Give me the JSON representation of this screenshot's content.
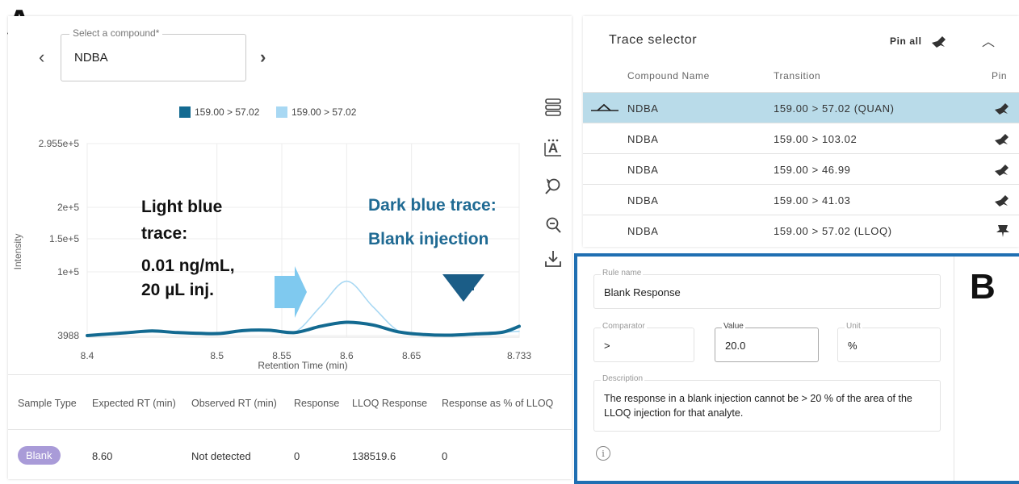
{
  "panel_labels": {
    "a": "A",
    "b": "B"
  },
  "compound_select": {
    "label": "Select a compound*",
    "value": "NDBA",
    "prev": "‹",
    "next": "›"
  },
  "chart_legend": [
    {
      "label": "159.00 > 57.02",
      "color": "#136a91"
    },
    {
      "label": "159.00 > 57.02",
      "color": "#a8d8f3"
    }
  ],
  "chart_data": {
    "type": "line",
    "ylabel": "Intensity",
    "xlabel": "Retention Time (min)",
    "y_ticks": [
      "2.955e+5",
      "2e+5",
      "1.5e+5",
      "1e+5",
      "3988"
    ],
    "x_ticks": [
      "8.4",
      "8.5",
      "8.55",
      "8.6",
      "8.65",
      "8.733"
    ],
    "x_tick_values": [
      8.4,
      8.5,
      8.55,
      8.6,
      8.65,
      8.733
    ],
    "xlim": [
      8.4,
      8.733
    ],
    "series": [
      {
        "name": "159.00 > 57.02",
        "color": "#a8d8f3",
        "x": [
          8.4,
          8.43,
          8.45,
          8.47,
          8.5,
          8.52,
          8.54,
          8.56,
          8.58,
          8.6,
          8.62,
          8.64,
          8.66,
          8.68,
          8.7,
          8.72,
          8.733
        ],
        "y": [
          4500,
          8200,
          11000,
          8500,
          7000,
          11500,
          12500,
          9000,
          48000,
          86000,
          48000,
          11000,
          6000,
          4800,
          6500,
          9000,
          10500
        ]
      },
      {
        "name": "159.00 > 57.02",
        "color": "#136a91",
        "x": [
          8.4,
          8.43,
          8.45,
          8.47,
          8.5,
          8.52,
          8.54,
          8.56,
          8.58,
          8.6,
          8.62,
          8.64,
          8.66,
          8.68,
          8.7,
          8.72,
          8.733
        ],
        "y": [
          4000,
          8200,
          11000,
          8500,
          7000,
          11500,
          12000,
          8500,
          18000,
          24000,
          20000,
          9500,
          5500,
          4600,
          6500,
          9000,
          18000
        ]
      }
    ]
  },
  "annotations": {
    "light_1": "Light blue",
    "light_2": "trace:",
    "light_3": "0.01 ng/mL,",
    "light_4": "20 µL inj.",
    "dark_1": "Dark blue trace:",
    "dark_2": "Blank injection"
  },
  "table": {
    "headers": [
      "Sample Type",
      "Expected RT (min)",
      "Observed RT (min)",
      "Response",
      "LLOQ Response",
      "Response as % of LLOQ"
    ],
    "row": {
      "sample_type": "Blank",
      "expected_rt": "8.60",
      "observed_rt": "Not detected",
      "response": "0",
      "lloq_response": "138519.6",
      "pct": "0"
    }
  },
  "trace_selector": {
    "title": "Trace selector",
    "pin_all": "Pin all",
    "collapse": "︿",
    "columns": [
      "Compound Name",
      "Transition",
      "Pin"
    ],
    "rows": [
      {
        "compound": "NDBA",
        "transition": "159.00 > 57.02 (QUAN)",
        "selected": true
      },
      {
        "compound": "NDBA",
        "transition": "159.00 > 103.02",
        "selected": false
      },
      {
        "compound": "NDBA",
        "transition": "159.00 > 46.99",
        "selected": false
      },
      {
        "compound": "NDBA",
        "transition": "159.00 > 41.03",
        "selected": false
      },
      {
        "compound": "NDBA",
        "transition": "159.00 > 57.02 (LLOQ)",
        "selected": false
      }
    ]
  },
  "rule": {
    "rule_name_label": "Rule name",
    "rule_name": "Blank Response",
    "comparator_label": "Comparator",
    "comparator": ">",
    "value_label": "Value",
    "value": "20.0",
    "unit_label": "Unit",
    "unit": "%",
    "description_label": "Description",
    "description_1": "The response in a blank injection cannot be > 20 % of the area of the",
    "description_2": "LLOQ injection for that analyte.",
    "info_symbol": "i"
  }
}
